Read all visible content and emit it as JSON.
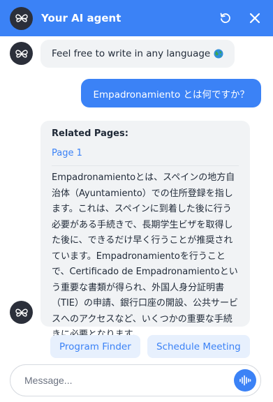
{
  "header": {
    "title": "Your AI agent",
    "logo_icon": "butterfly-logo-icon",
    "refresh_icon": "refresh-icon",
    "close_icon": "close-icon"
  },
  "messages": {
    "greeting": "Feel free to write in any language",
    "greeting_icon": "globe-icon",
    "user_question": "Empadronamiento とは何ですか？",
    "answer": {
      "heading": "Related Pages:",
      "link": "Page 1",
      "text": "Empadronamientoとは、スペインの地方自治体（Ayuntamiento）での住所登録を指します。これは、スペインに到着した後に行う必要がある手続きで、長期学生ビザを取得した後に、できるだけ早く行うことが推奨されています。Empadronamientoを行うことで、Certificado de Empadronamientoという重要な書類が得られ、外国人身分証明書（TIE）の申請、銀行口座の開設、公共サービスへのアクセスなど、いくつかの重要な手続きに必要となります。"
    }
  },
  "quick_replies": [
    "Program Finder",
    "Schedule Meeting"
  ],
  "composer": {
    "placeholder": "Message...",
    "send_icon": "voice-wave-icon"
  },
  "colors": {
    "accent": "#3b82f6",
    "bubble": "#f1f3f5",
    "avatar": "#2b2f3a",
    "quick_reply_bg": "#e7f0fd"
  }
}
